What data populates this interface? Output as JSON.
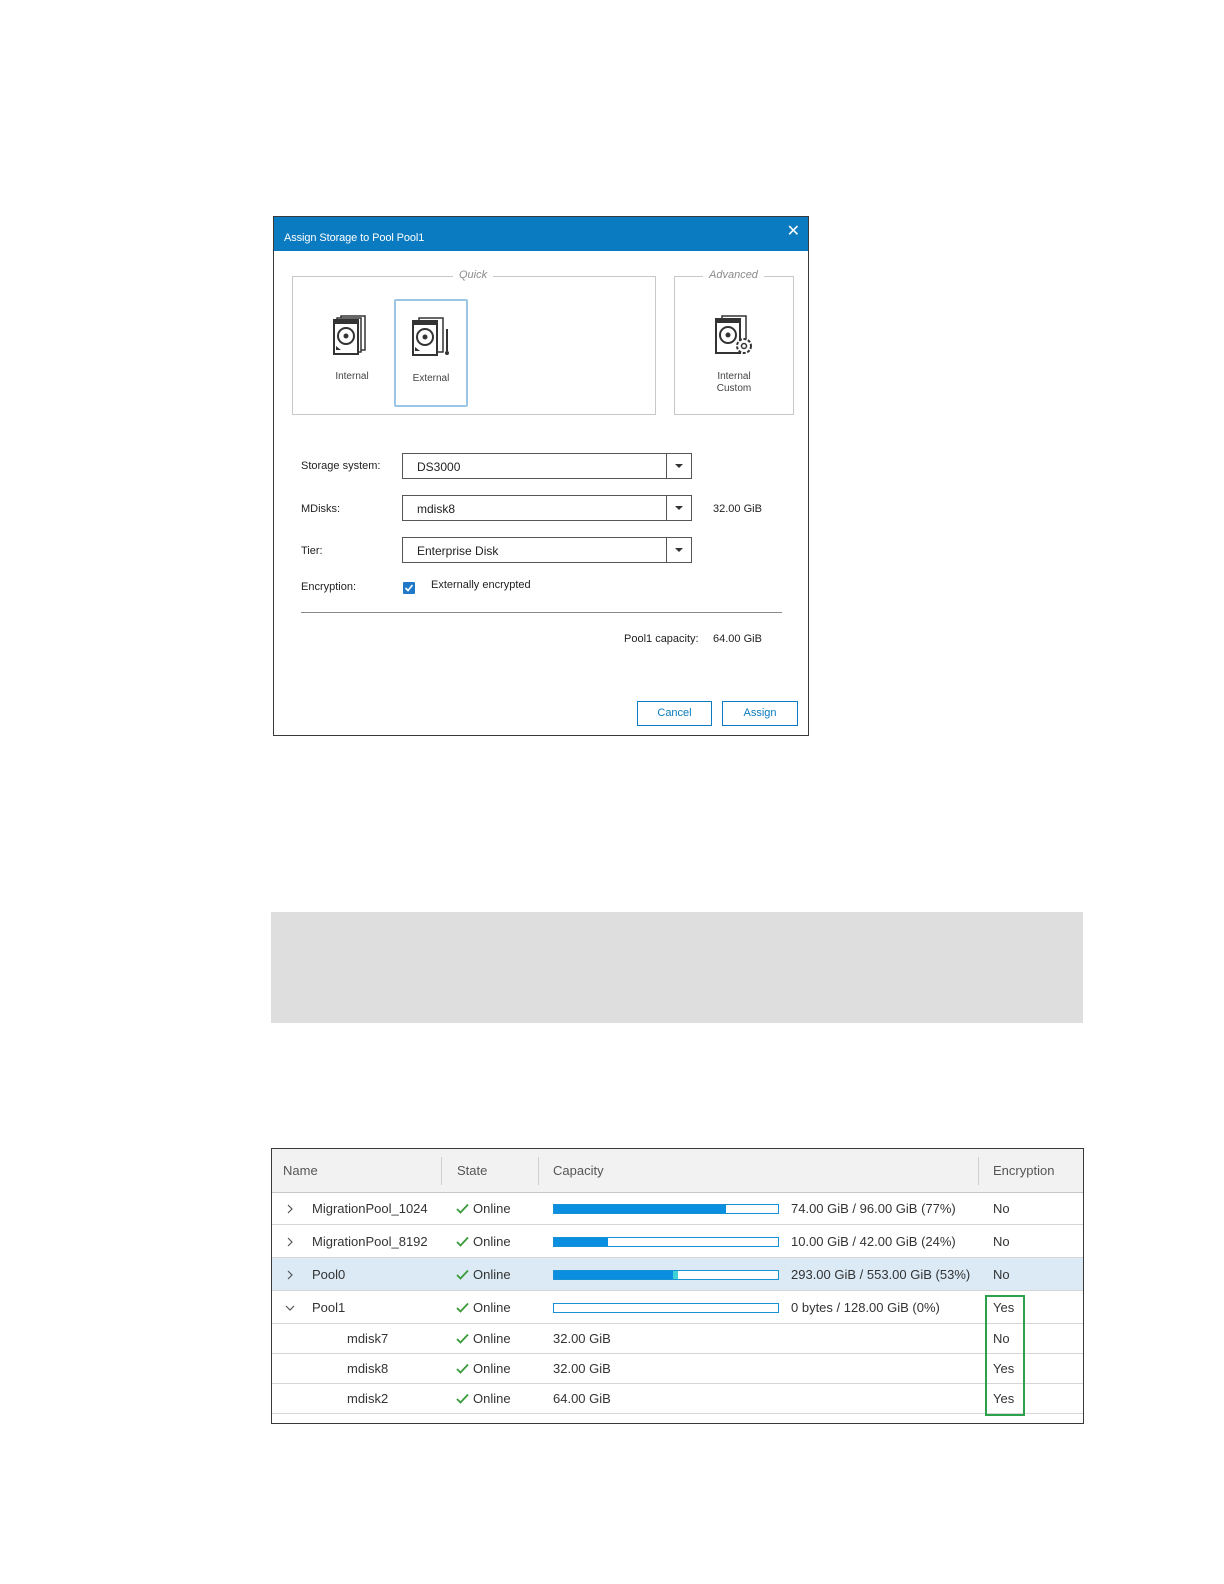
{
  "dialog": {
    "title": "Assign Storage to Pool Pool1",
    "quick_legend": "Quick",
    "advanced_legend": "Advanced",
    "tiles": {
      "internal": "Internal",
      "external": "External",
      "internal_custom_1": "Internal",
      "internal_custom_2": "Custom"
    },
    "storage_system_label": "Storage system:",
    "storage_system_value": "DS3000",
    "mdisks_label": "MDisks:",
    "mdisks_value": "mdisk8",
    "mdisks_size": "32.00 GiB",
    "tier_label": "Tier:",
    "tier_value": "Enterprise Disk",
    "encryption_label": "Encryption:",
    "encryption_checkbox_label": "Externally encrypted",
    "encryption_checked": true,
    "capacity_label": "Pool1 capacity:",
    "capacity_value": "64.00 GiB",
    "cancel_label": "Cancel",
    "assign_label": "Assign",
    "accent_color": "#0a7bc0"
  },
  "table": {
    "headers": [
      "Name",
      "State",
      "Capacity",
      "Encryption"
    ],
    "rows": [
      {
        "name": "MigrationPool_1024",
        "state": "Online",
        "capacity": "74.00 GiB / 96.00 GiB (77%)",
        "usage_pct": 77,
        "encryption": "No",
        "expand": "collapsed"
      },
      {
        "name": "MigrationPool_8192",
        "state": "Online",
        "capacity": "10.00 GiB / 42.00 GiB (24%)",
        "usage_pct": 24,
        "encryption": "No",
        "expand": "collapsed"
      },
      {
        "name": "Pool0",
        "state": "Online",
        "capacity": "293.00 GiB / 553.00 GiB (53%)",
        "usage_pct": 53,
        "encryption": "No",
        "expand": "collapsed",
        "selected": true
      },
      {
        "name": "Pool1",
        "state": "Online",
        "capacity": "0 bytes / 128.00 GiB (0%)",
        "usage_pct": 0,
        "encryption": "Yes",
        "expand": "expanded"
      },
      {
        "name": "mdisk7",
        "state": "Online",
        "capacity": "32.00 GiB",
        "encryption": "No",
        "child": true
      },
      {
        "name": "mdisk8",
        "state": "Online",
        "capacity": "32.00 GiB",
        "encryption": "Yes",
        "child": true
      },
      {
        "name": "mdisk2",
        "state": "Online",
        "capacity": "64.00 GiB",
        "encryption": "Yes",
        "child": true
      }
    ],
    "online_color": "#3a9a3a",
    "highlight_color": "#2aa14a"
  }
}
